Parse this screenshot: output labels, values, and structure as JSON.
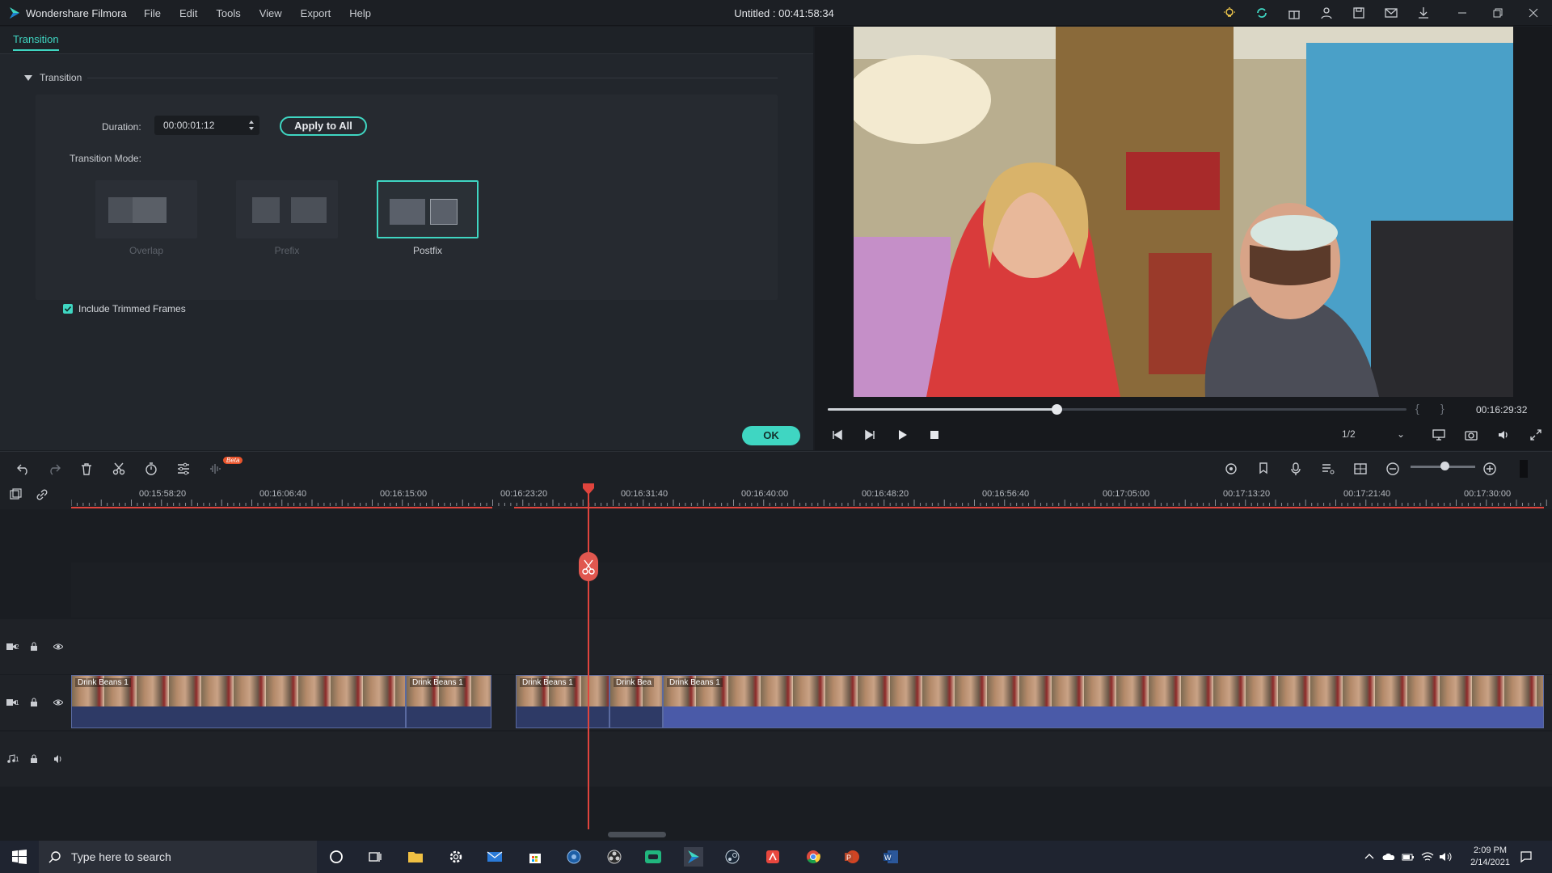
{
  "app": {
    "name": "Wondershare Filmora",
    "doc_title": "Untitled : 00:41:58:34"
  },
  "menu": [
    "File",
    "Edit",
    "Tools",
    "View",
    "Export",
    "Help"
  ],
  "left_panel": {
    "tab": "Transition",
    "section": "Transition",
    "duration_label": "Duration:",
    "duration_value": "00:00:01:12",
    "apply_all": "Apply to All",
    "mode_label": "Transition Mode:",
    "modes": [
      {
        "label": "Overlap",
        "selected": false
      },
      {
        "label": "Prefix",
        "selected": false
      },
      {
        "label": "Postfix",
        "selected": true
      }
    ],
    "include_trimmed": {
      "label": "Include Trimmed Frames",
      "checked": true
    },
    "ok": "OK"
  },
  "preview": {
    "time": "00:16:29:32",
    "progress": 0.395,
    "quality": "1/2"
  },
  "timeline": {
    "badge": "Beta",
    "ticks": [
      "00:15:58:20",
      "00:16:06:40",
      "00:16:15:00",
      "00:16:23:20",
      "00:16:31:40",
      "00:16:40:00",
      "00:16:48:20",
      "00:16:56:40",
      "00:17:05:00",
      "00:17:13:20",
      "00:17:21:40",
      "00:17:30:00"
    ],
    "tracks": [
      {
        "id": "2",
        "type": "video"
      },
      {
        "id": "1",
        "type": "video"
      },
      {
        "id": "1",
        "type": "audio"
      }
    ],
    "clips": [
      {
        "label": "Drink Beans 1"
      },
      {
        "label": "Drink Beans 1"
      },
      {
        "label": "Drink Beans 1"
      },
      {
        "label": "Drink Bea"
      },
      {
        "label": "Drink Beans 1"
      }
    ]
  },
  "taskbar": {
    "search_placeholder": "Type here to search",
    "time": "2:09 PM",
    "date": "2/14/2021"
  },
  "colors": {
    "accent": "#3fd6c2",
    "playhead": "#e0443d",
    "clip": "#3a4a7a"
  }
}
